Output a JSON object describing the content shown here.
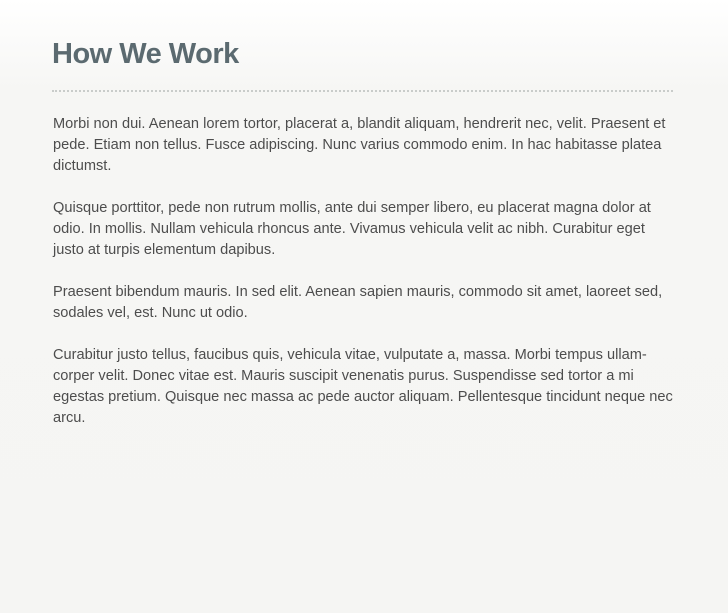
{
  "page": {
    "title": "How We Work",
    "paragraphs": [
      "Morbi non dui. Aenean lorem tortor, placerat a, blandit aliquam, hendrerit nec, velit. Praesent et pede. Etiam non tellus. Fusce adipiscing. Nunc varius commodo enim. In hac habitasse platea dictumst.",
      "Quisque porttitor, pede non rutrum mollis, ante dui semper libero, eu placerat magna dolor at odio. In mollis. Nullam vehicula rhoncus ante. Vivamus vehicula velit ac nibh. Curabitur eget justo at turpis elementum dapibus.",
      "Praesent bibendum mauris. In sed elit. Aenean sapien mauris, commodo sit amet, laoreet sed, sodales vel, est. Nunc ut odio.",
      "Curabitur justo tellus, faucibus quis, vehicula vitae, vulputate a, massa. Morbi tempus ullam-corper velit. Donec vitae est. Mauris suscipit venenatis purus. Suspendisse sed tortor a mi egestas pretium. Quisque nec massa ac pede auctor aliquam. Pellentesque tincidunt neque nec arcu."
    ]
  },
  "colors": {
    "title": "#5b6a70",
    "text": "#4d4d4d",
    "divider": "#c9ccca",
    "background": "#f5f5f3"
  }
}
